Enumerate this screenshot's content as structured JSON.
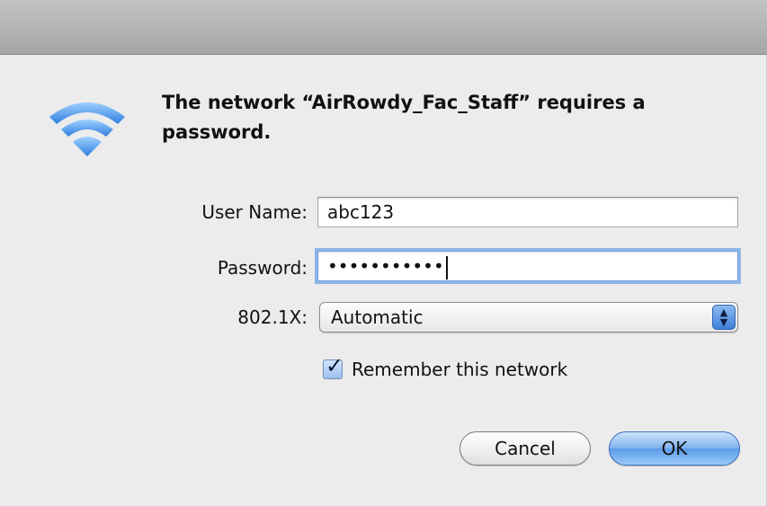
{
  "dialog": {
    "message": "The network “AirRowdy_Fac_Staff” requires a password.",
    "icon": "wifi-icon"
  },
  "form": {
    "username_label": "User Name:",
    "username_value": "abc123",
    "password_label": "Password:",
    "password_value": "•••••••••••",
    "eap_label": "802.1X:",
    "eap_value": "Automatic",
    "remember_label": "Remember this network",
    "remember_checked": true
  },
  "buttons": {
    "cancel": "Cancel",
    "ok": "OK"
  },
  "colors": {
    "accent": "#5a9be8",
    "wifi_blue": "#4a90e2",
    "background": "#ececec"
  }
}
